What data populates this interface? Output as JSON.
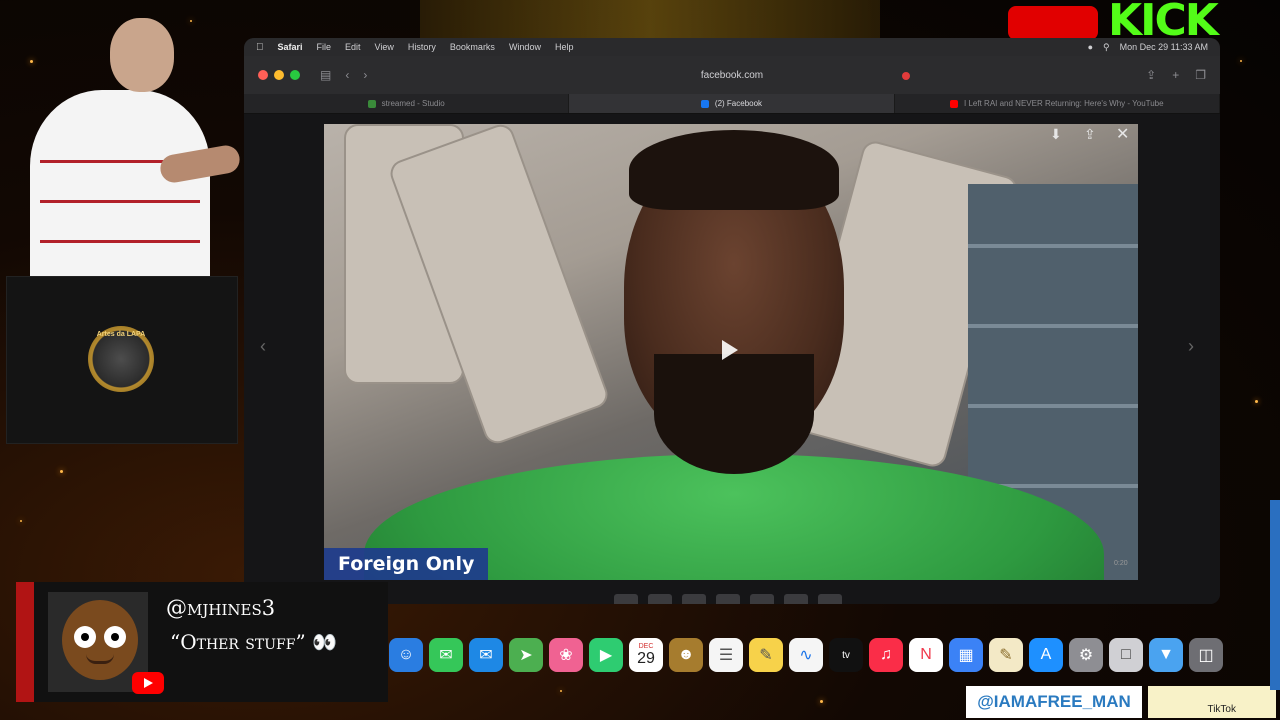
{
  "mac_menubar": {
    "app_name": "Safari",
    "menus": [
      "File",
      "Edit",
      "View",
      "History",
      "Bookmarks",
      "Window",
      "Help"
    ],
    "clock": "Mon Dec 29  11:33 AM"
  },
  "browser": {
    "url": "facebook.com",
    "tabs": [
      {
        "label": "streamed - Studio",
        "active": false
      },
      {
        "label": "(2) Facebook",
        "active": true
      },
      {
        "label": "I Left RAI and NEVER Returning: Here's Why - YouTube",
        "active": false
      }
    ]
  },
  "video": {
    "lower_third": "Foreign Only",
    "timestamp": "0:20"
  },
  "dock": {
    "calendar_day": "29",
    "calendar_month": "DEC",
    "tv_label": "tv"
  },
  "chat": {
    "username": "@mjhines3",
    "message": "“Other stuff” 👀"
  },
  "overlay": {
    "badge_text": "Artes da LAPA",
    "social_handle": "@IAMAFREE_MAN",
    "tiktok_label": "TikTok",
    "kick_text": "KICK"
  },
  "colors": {
    "kick_green": "#53fc18",
    "youtube_red": "#ff0000",
    "lower_third_blue": "#1e3c8c",
    "chat_bar_red": "#b11414"
  }
}
